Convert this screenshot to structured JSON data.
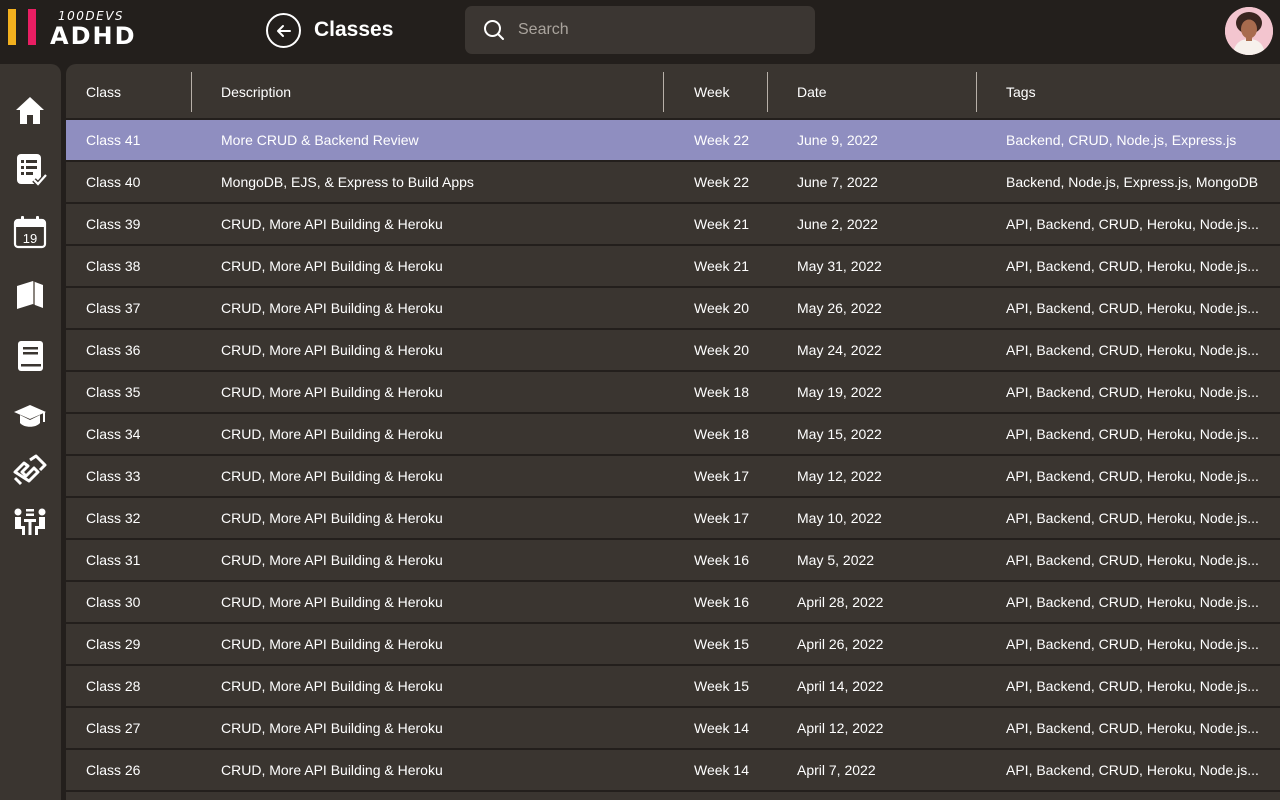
{
  "brand": {
    "super": "100DEVS",
    "name": "ADHD",
    "colors": [
      "#f2b01e",
      "#e91e63"
    ]
  },
  "header": {
    "title": "Classes",
    "back_icon": "arrow-left-icon"
  },
  "search": {
    "placeholder": "Search",
    "value": ""
  },
  "sidebar": {
    "items": [
      {
        "name": "home-icon"
      },
      {
        "name": "checklist-icon"
      },
      {
        "name": "calendar-icon",
        "badge": "19"
      },
      {
        "name": "books-icon"
      },
      {
        "name": "book-icon"
      },
      {
        "name": "graduation-cap-icon"
      },
      {
        "name": "handshake-icon"
      },
      {
        "name": "meeting-icon"
      }
    ]
  },
  "table": {
    "columns": [
      "Class",
      "Description",
      "Week",
      "Date",
      "Tags"
    ],
    "selected_row": 0,
    "rows": [
      {
        "class": "Class 41",
        "description": "More CRUD & Backend Review",
        "week": "Week 22",
        "date": "June 9, 2022",
        "tags": "Backend, CRUD, Node.js, Express.js"
      },
      {
        "class": "Class 40",
        "description": "MongoDB, EJS, & Express to Build Apps",
        "week": "Week 22",
        "date": "June 7, 2022",
        "tags": "Backend, Node.js, Express.js, MongoDB"
      },
      {
        "class": "Class 39",
        "description": "CRUD, More API Building & Heroku",
        "week": "Week 21",
        "date": "June 2, 2022",
        "tags": "API, Backend, CRUD, Heroku, Node.js..."
      },
      {
        "class": "Class 38",
        "description": "CRUD, More API Building & Heroku",
        "week": "Week 21",
        "date": "May 31, 2022",
        "tags": "API, Backend, CRUD, Heroku, Node.js..."
      },
      {
        "class": "Class 37",
        "description": "CRUD, More API Building & Heroku",
        "week": "Week 20",
        "date": "May 26, 2022",
        "tags": "API, Backend, CRUD, Heroku, Node.js..."
      },
      {
        "class": "Class 36",
        "description": "CRUD, More API Building & Heroku",
        "week": "Week 20",
        "date": "May 24, 2022",
        "tags": "API, Backend, CRUD, Heroku, Node.js..."
      },
      {
        "class": "Class 35",
        "description": "CRUD, More API Building & Heroku",
        "week": "Week 18",
        "date": "May 19, 2022",
        "tags": "API, Backend, CRUD, Heroku, Node.js..."
      },
      {
        "class": "Class 34",
        "description": "CRUD, More API Building & Heroku",
        "week": "Week 18",
        "date": "May 15, 2022",
        "tags": "API, Backend, CRUD, Heroku, Node.js..."
      },
      {
        "class": "Class 33",
        "description": "CRUD, More API Building & Heroku",
        "week": "Week 17",
        "date": "May 12, 2022",
        "tags": "API, Backend, CRUD, Heroku, Node.js..."
      },
      {
        "class": "Class 32",
        "description": "CRUD, More API Building & Heroku",
        "week": "Week 17",
        "date": "May 10, 2022",
        "tags": "API, Backend, CRUD, Heroku, Node.js..."
      },
      {
        "class": "Class 31",
        "description": "CRUD, More API Building & Heroku",
        "week": "Week 16",
        "date": "May 5, 2022",
        "tags": "API, Backend, CRUD, Heroku, Node.js..."
      },
      {
        "class": "Class 30",
        "description": "CRUD, More API Building & Heroku",
        "week": "Week 16",
        "date": "April 28, 2022",
        "tags": "API, Backend, CRUD, Heroku, Node.js..."
      },
      {
        "class": "Class 29",
        "description": "CRUD, More API Building & Heroku",
        "week": "Week 15",
        "date": "April 26, 2022",
        "tags": "API, Backend, CRUD, Heroku, Node.js..."
      },
      {
        "class": "Class 28",
        "description": "CRUD, More API Building & Heroku",
        "week": "Week 15",
        "date": "April 14, 2022",
        "tags": "API, Backend, CRUD, Heroku, Node.js..."
      },
      {
        "class": "Class 27",
        "description": "CRUD, More API Building & Heroku",
        "week": "Week 14",
        "date": "April 12, 2022",
        "tags": "API, Backend, CRUD, Heroku, Node.js..."
      },
      {
        "class": "Class 26",
        "description": "CRUD, More API Building & Heroku",
        "week": "Week 14",
        "date": "April 7, 2022",
        "tags": "API, Backend, CRUD, Heroku, Node.js..."
      }
    ]
  }
}
